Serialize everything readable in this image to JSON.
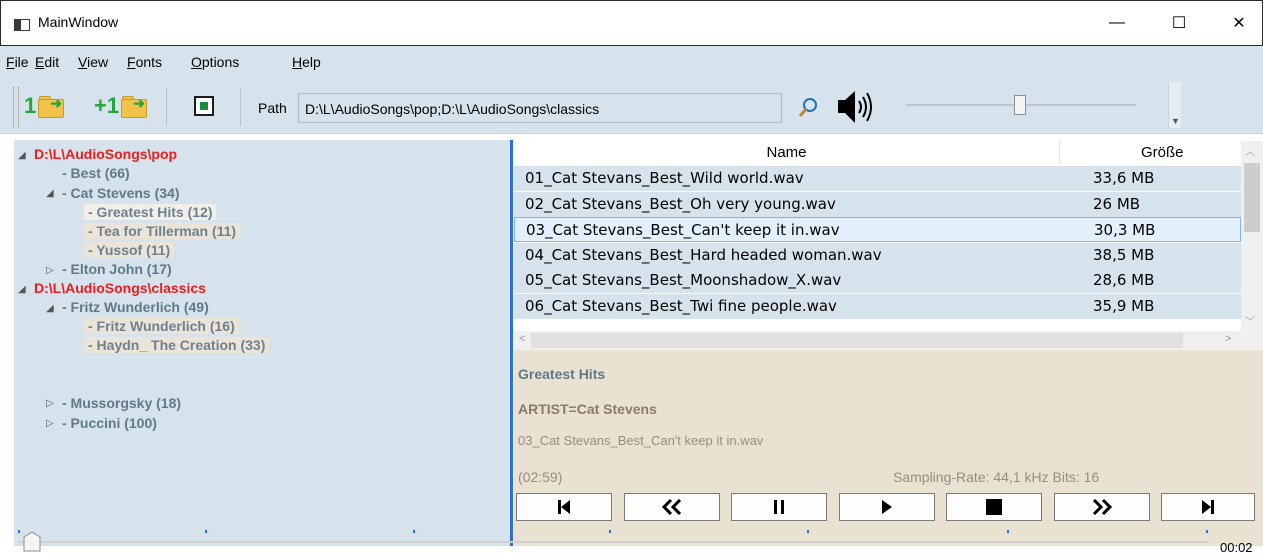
{
  "window": {
    "title": "MainWindow",
    "controls": {
      "minimize": "—",
      "maximize": "☐",
      "close": "✕"
    }
  },
  "menu": [
    {
      "key": "F",
      "rest": "ile"
    },
    {
      "key": "E",
      "rest": "dit"
    },
    {
      "key": "V",
      "rest": "iew"
    },
    {
      "key": "F",
      "rest": "onts"
    },
    {
      "key": "O",
      "rest": "ptions"
    },
    {
      "key": "H",
      "rest": "elp"
    }
  ],
  "toolbar": {
    "open_one_label": "1",
    "add_one_label": "+1",
    "path_label": "Path",
    "path_value": "D:\\L\\AudioSongs\\pop;D:\\L\\AudioSongs\\classics",
    "icons": [
      "folder-open-icon",
      "folder-add-icon",
      "stop-square-icon",
      "search-icon",
      "speaker-icon"
    ],
    "volume": 0.47
  },
  "tree": {
    "expander_open": "◢",
    "expander_closed": "▷",
    "items": [
      {
        "label": "D:\\L\\AudioSongs\\pop"
      },
      {
        "label": "- Best (66)"
      },
      {
        "label": "- Cat Stevens (34)"
      },
      {
        "label": "- Greatest Hits (12)"
      },
      {
        "label": "- Tea for Tillerman (11)"
      },
      {
        "label": "- Yussof (11)"
      },
      {
        "label": "- Elton John (17)"
      },
      {
        "label": "D:\\L\\AudioSongs\\classics"
      },
      {
        "label": "- Fritz Wunderlich (49)"
      },
      {
        "label": "- Fritz Wunderlich (16)"
      },
      {
        "label": "- Haydn_ The Creation (33)"
      },
      {
        "label": "- Mussorgsky (18)"
      },
      {
        "label": "- Puccini (100)"
      }
    ]
  },
  "files": {
    "columns": [
      "Name",
      "Größe"
    ],
    "rows": [
      {
        "name": "01_Cat Stevans_Best_Wild world.wav",
        "size": "33,6 MB"
      },
      {
        "name": "02_Cat Stevans_Best_Oh very young.wav",
        "size": "26 MB"
      },
      {
        "name": "03_Cat Stevans_Best_Can't keep it in.wav",
        "size": "30,3 MB"
      },
      {
        "name": "04_Cat Stevans_Best_Hard headed woman.wav",
        "size": "38,5 MB"
      },
      {
        "name": "05_Cat Stevans_Best_Moonshadow_X.wav",
        "size": "28,6 MB"
      },
      {
        "name": "06_Cat Stevans_Best_Twi fine people.wav",
        "size": "35,9 MB"
      }
    ],
    "selected_index": 2
  },
  "info": {
    "album": "Greatest Hits",
    "artist": "ARTIST=Cat Stevens",
    "filename": "03_Cat Stevans_Best_Can't keep it in.wav",
    "duration": "(02:59)",
    "sampling": "Sampling-Rate: 44,1 kHz  Bits: 16"
  },
  "player": {
    "buttons": [
      "previous-track",
      "rewind",
      "pause",
      "play",
      "stop",
      "fast-forward",
      "next-track"
    ]
  },
  "position": {
    "time": "00:02",
    "fraction": 0.01
  },
  "colors": {
    "root": "#ec1c1c",
    "node": "#5f7a86",
    "pane": "#d7e3ec",
    "info": "#e9e2d3",
    "splitter": "#2b6fd8"
  }
}
